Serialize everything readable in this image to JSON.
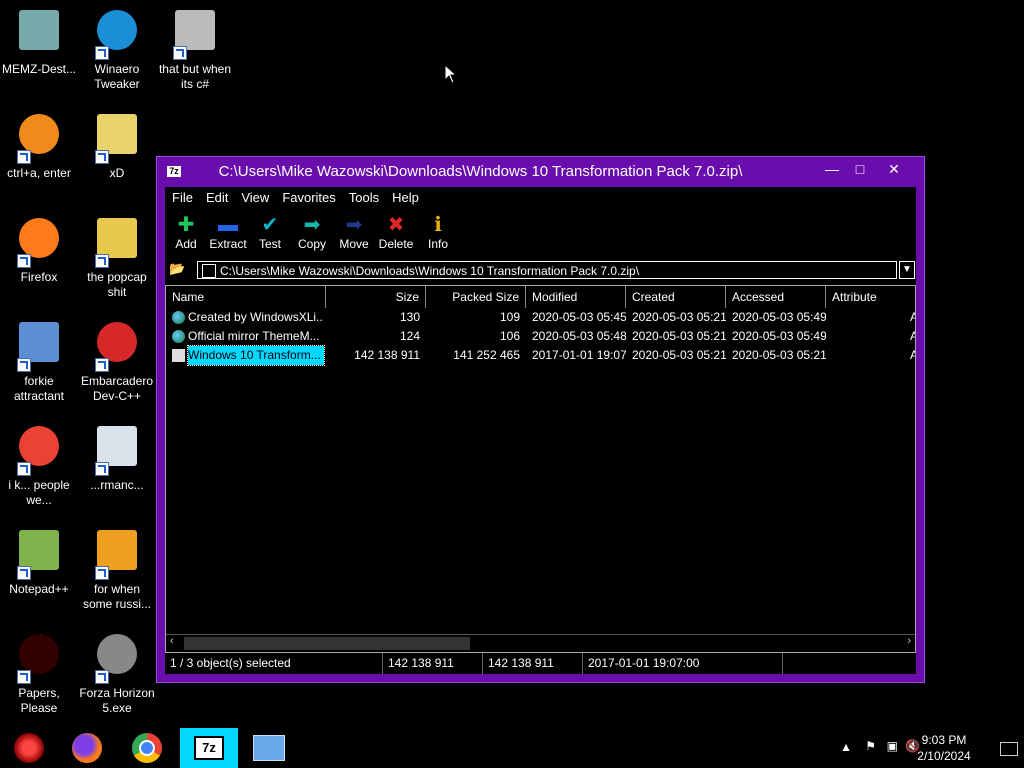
{
  "desktop_icons": [
    {
      "label": "MEMZ-Dest...",
      "icon": "recycle-bin-icon"
    },
    {
      "label": "Winaero Tweaker",
      "icon": "winaero-icon"
    },
    {
      "label": "that but when its c#",
      "icon": "stacked-windows-icon"
    },
    {
      "label": "ctrl+a, enter",
      "icon": "orange-ring-icon"
    },
    {
      "label": "xD",
      "icon": "hxd-icon"
    },
    {
      "label": "Firefox",
      "icon": "firefox-icon"
    },
    {
      "label": "the popcap shit",
      "icon": "folder-icon"
    },
    {
      "label": "forkie attractant",
      "icon": "computer-settings-icon"
    },
    {
      "label": "Embarcadero Dev-C++",
      "icon": "devcpp-icon"
    },
    {
      "label": "i k... people we...",
      "icon": "chrome-icon"
    },
    {
      "label": "...rmanc...",
      "icon": "performance-icon"
    },
    {
      "label": "Notepad++",
      "icon": "notepadpp-icon"
    },
    {
      "label": "for when some russi...",
      "icon": "de-icon"
    },
    {
      "label": "Papers, Please",
      "icon": "papers-please-icon"
    },
    {
      "label": "Forza Horizon 5.exe",
      "icon": "flash-icon"
    }
  ],
  "window": {
    "title": "C:\\Users\\Mike Wazowski\\Downloads\\Windows 10 Transformation Pack 7.0.zip\\",
    "app_icon": "7z",
    "menu": [
      "File",
      "Edit",
      "View",
      "Favorites",
      "Tools",
      "Help"
    ],
    "toolbar": [
      {
        "label": "Add",
        "icon": "plus-icon",
        "color": "#22c55e",
        "glyph": "✚"
      },
      {
        "label": "Extract",
        "icon": "minus-icon",
        "color": "#2563eb",
        "glyph": "▬"
      },
      {
        "label": "Test",
        "icon": "check-icon",
        "color": "#06b6d4",
        "glyph": "✔"
      },
      {
        "label": "Copy",
        "icon": "copy-arrow-icon",
        "color": "#14b8a6",
        "glyph": "➡"
      },
      {
        "label": "Move",
        "icon": "move-arrow-icon",
        "color": "#1e3a8a",
        "glyph": "➡"
      },
      {
        "label": "Delete",
        "icon": "delete-x-icon",
        "color": "#dc2626",
        "glyph": "✖"
      },
      {
        "label": "Info",
        "icon": "info-icon",
        "color": "#eab308",
        "glyph": "ℹ"
      }
    ],
    "address": "C:\\Users\\Mike Wazowski\\Downloads\\Windows 10 Transformation Pack 7.0.zip\\",
    "columns": [
      "Name",
      "Size",
      "Packed Size",
      "Modified",
      "Created",
      "Accessed",
      "Attribute"
    ],
    "rows": [
      {
        "name": "Created by WindowsXLi...",
        "size": "130",
        "packed": "109",
        "modified": "2020-05-03 05:45",
        "created": "2020-05-03 05:21",
        "accessed": "2020-05-03 05:49",
        "attr": "A",
        "icon": "url-globe-icon",
        "selected": false
      },
      {
        "name": "Official mirror ThemeM...",
        "size": "124",
        "packed": "106",
        "modified": "2020-05-03 05:48",
        "created": "2020-05-03 05:21",
        "accessed": "2020-05-03 05:49",
        "attr": "A",
        "icon": "url-globe-icon",
        "selected": false
      },
      {
        "name": "Windows 10 Transform...",
        "size": "142 138 911",
        "packed": "141 252 465",
        "modified": "2017-01-01 19:07",
        "created": "2020-05-03 05:21",
        "accessed": "2020-05-03 05:21",
        "attr": "A",
        "icon": "exe-file-icon",
        "selected": true
      }
    ],
    "status": {
      "selection": "1 / 3 object(s) selected",
      "size": "142 138 911",
      "packed": "142 138 911",
      "date": "2017-01-01 19:07:00"
    }
  },
  "taskbar": {
    "buttons": [
      "memz-icon",
      "firefox-icon",
      "chrome-icon",
      "7zip-icon",
      "control-panel-icon"
    ],
    "time": "9:03 PM",
    "date": "2/10/2024"
  }
}
